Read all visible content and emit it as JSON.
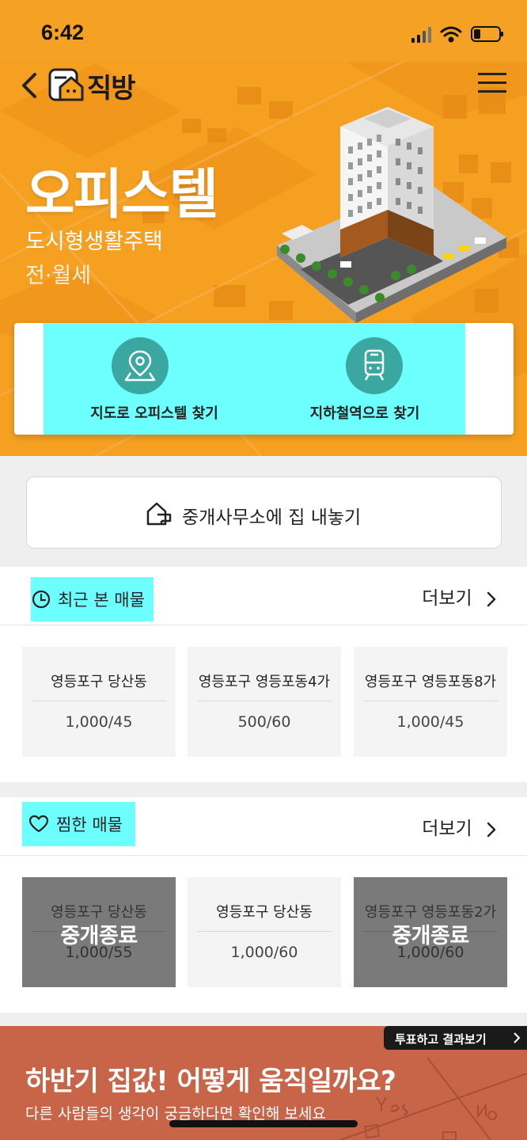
{
  "status": {
    "time": "6:42",
    "icons": [
      "signal-icon",
      "wifi-icon",
      "battery-icon"
    ]
  },
  "nav": {
    "logo_text": "직방",
    "icons": [
      "back-icon",
      "logo-icon",
      "menu-icon"
    ]
  },
  "hero": {
    "title": "오피스텔",
    "subtitle_1": "도시형생활주택",
    "subtitle_2": "전·월세"
  },
  "search": {
    "map_label": "지도로 오피스텔 찾기",
    "subway_label": "지하철역으로 찾기",
    "icons": [
      "map-pin-icon",
      "train-icon"
    ]
  },
  "register": {
    "label": "중개사무소에 집 내놓기",
    "icon": "house-register-icon"
  },
  "recent": {
    "title": "최근 본 매물",
    "more": "더보기",
    "items": [
      {
        "name": "영등포구 당산동",
        "price": "1,000/45"
      },
      {
        "name": "영등포구 영등포동4가",
        "price": "500/60"
      },
      {
        "name": "영등포구 영등포동8가",
        "price": "1,000/45"
      }
    ]
  },
  "favorites": {
    "title": "찜한 매물",
    "more": "더보기",
    "items": [
      {
        "name": "영등포구 당산동",
        "price": "1,000/55",
        "badge": "중개종료"
      },
      {
        "name": "영등포구 당산동",
        "price": "1,000/60"
      },
      {
        "name": "영등포구 영등포동2가",
        "price": "1,000/60",
        "badge": "중개종료"
      }
    ]
  },
  "banner": {
    "vote_button": "투표하고 결과보기",
    "title": "하반기 집값! 어떻게 움직일까요?",
    "subtitle": "다른 사람들의 생각이 궁금하다면 확인해 보세요"
  },
  "colors": {
    "hero_orange": "#f5a021",
    "highlight_cyan": "#6dfefe",
    "icon_teal": "#3aa8a0",
    "banner_red": "#c86448"
  }
}
